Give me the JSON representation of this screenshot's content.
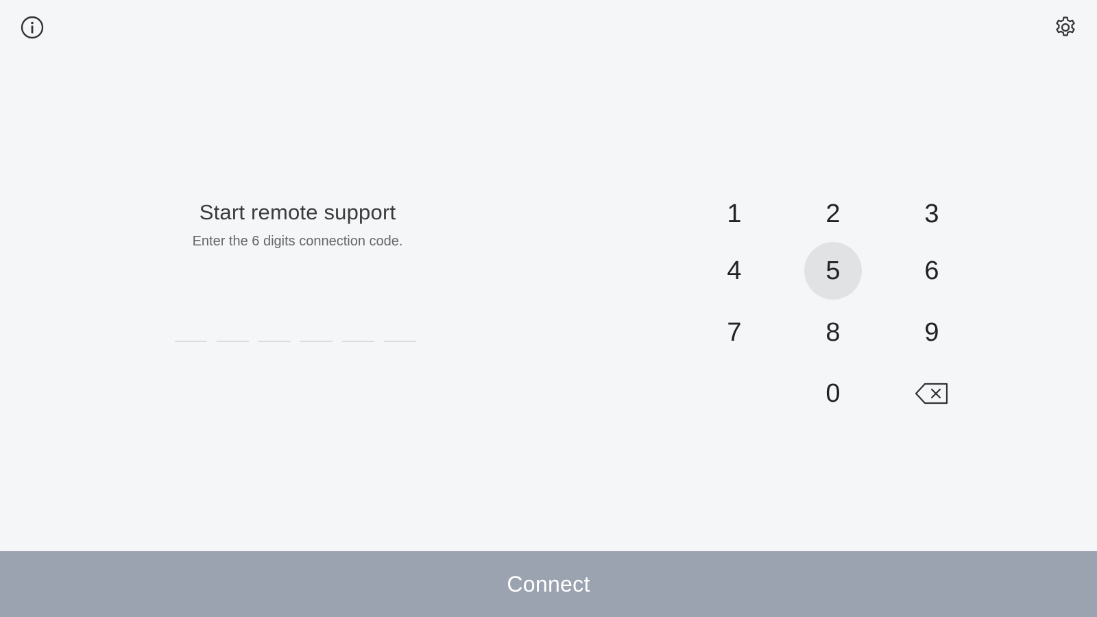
{
  "header": {
    "info_icon": "info-icon",
    "settings_icon": "gear-icon"
  },
  "main": {
    "title": "Start remote support",
    "subtitle": "Enter the 6 digits connection code.",
    "code_digits": [
      "",
      "",
      "",
      "",
      "",
      ""
    ]
  },
  "keypad": {
    "keys": [
      "1",
      "2",
      "3",
      "4",
      "5",
      "6",
      "7",
      "8",
      "9",
      "0"
    ],
    "pressed_key": "5",
    "backspace_icon": "backspace-icon"
  },
  "footer": {
    "connect_label": "Connect"
  },
  "colors": {
    "background": "#f5f6f8",
    "connect_bar": "#9ca3b0",
    "pressed_key": "#e1e2e4",
    "slot_line": "#d9dbdf"
  }
}
